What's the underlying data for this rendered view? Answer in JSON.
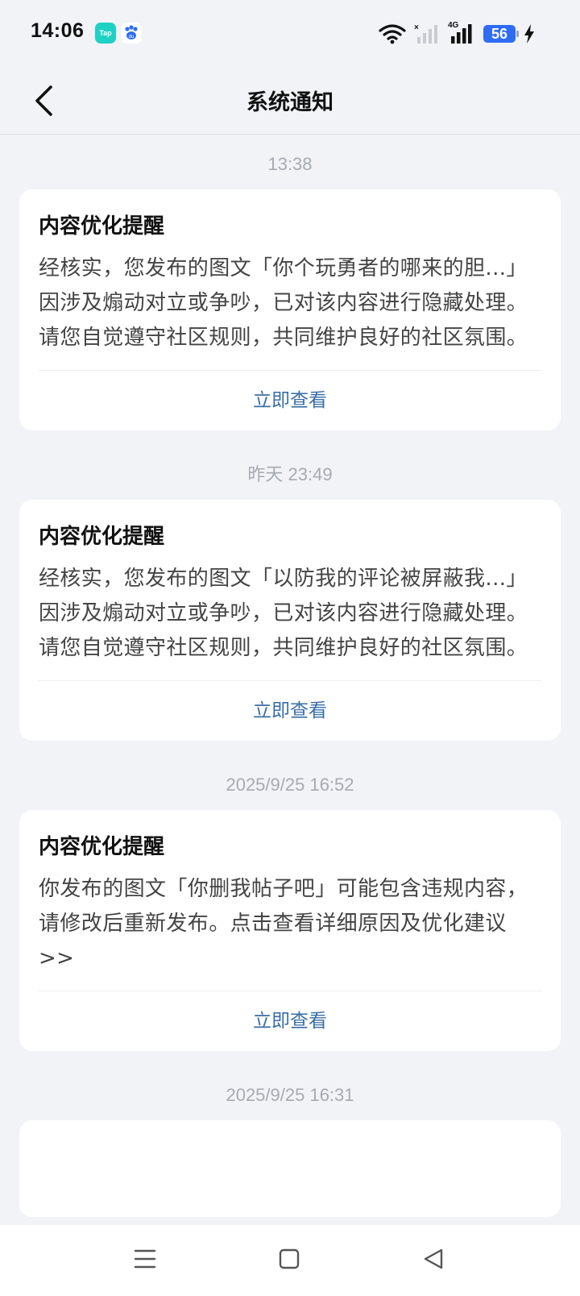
{
  "status_bar": {
    "time": "14:06",
    "apps": [
      "tap-icon",
      "baidu-icon"
    ],
    "tap_label": "Tap",
    "network": "4G",
    "battery": "56",
    "icons": [
      "wifi-icon",
      "no-signal-icon",
      "signal-icon",
      "battery-icon",
      "charging-icon"
    ]
  },
  "header": {
    "title": "系统通知",
    "back_icon": "chevron-left-icon"
  },
  "notifications": [
    {
      "time": "13:38",
      "title": "内容优化提醒",
      "body": "经核实，您发布的图文「你个玩勇者的哪来的胆...」因涉及煽动对立或争吵，已对该内容进行隐藏处理。请您自觉遵守社区规则，共同维护良好的社区氛围。",
      "action": "立即查看"
    },
    {
      "time": "昨天  23:49",
      "title": "内容优化提醒",
      "body": "经核实，您发布的图文「以防我的评论被屏蔽我...」因涉及煽动对立或争吵，已对该内容进行隐藏处理。请您自觉遵守社区规则，共同维护良好的社区氛围。",
      "action": "立即查看"
    },
    {
      "time": "2025/9/25  16:52",
      "title": "内容优化提醒",
      "body": "你发布的图文「你删我帖子吧」可能包含违规内容，请修改后重新发布。点击查看详细原因及优化建议>>",
      "action": "立即查看"
    },
    {
      "time": "2025/9/25  16:31"
    }
  ],
  "system_nav": {
    "icons": [
      "menu-icon",
      "home-icon",
      "back-icon"
    ]
  }
}
